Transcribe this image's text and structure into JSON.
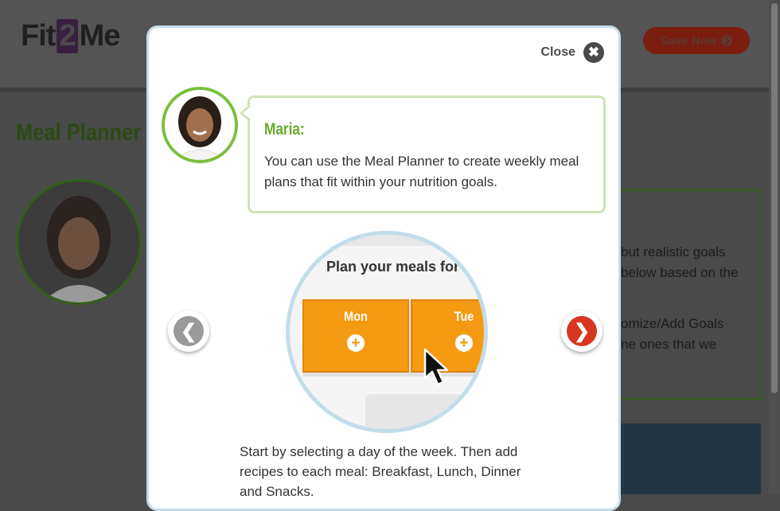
{
  "background": {
    "logo_pre": "Fit",
    "logo_mid": "2",
    "logo_post": "Me",
    "save_now_label": "Save Now",
    "page_title": "Meal Planner",
    "panel_text_lines": [
      "but realistic goals",
      "below based on the",
      "omize/Add Goals",
      "ne ones that we"
    ]
  },
  "modal": {
    "close_label": "Close",
    "speaker_name": "Maria:",
    "speech": "You can use the Meal Planner to create weekly meal plans that fit within your nutrition goals.",
    "illustration": {
      "title": "Plan your meals for w",
      "days": [
        "Mon",
        "Tue"
      ],
      "add_symbol": "+"
    },
    "description": "Start by selecting a day of the week. Then add recipes to each meal: Breakfast, Lunch, Dinner and Snacks."
  },
  "colors": {
    "accent_green": "#6aac2e",
    "next_red": "#d8371f",
    "day_orange": "#f59a12",
    "modal_border": "#c6dbe8"
  },
  "icons": {
    "close": "close-icon",
    "prev": "chevron-left-icon",
    "next": "chevron-right-icon",
    "cursor": "mouse-pointer-icon"
  }
}
